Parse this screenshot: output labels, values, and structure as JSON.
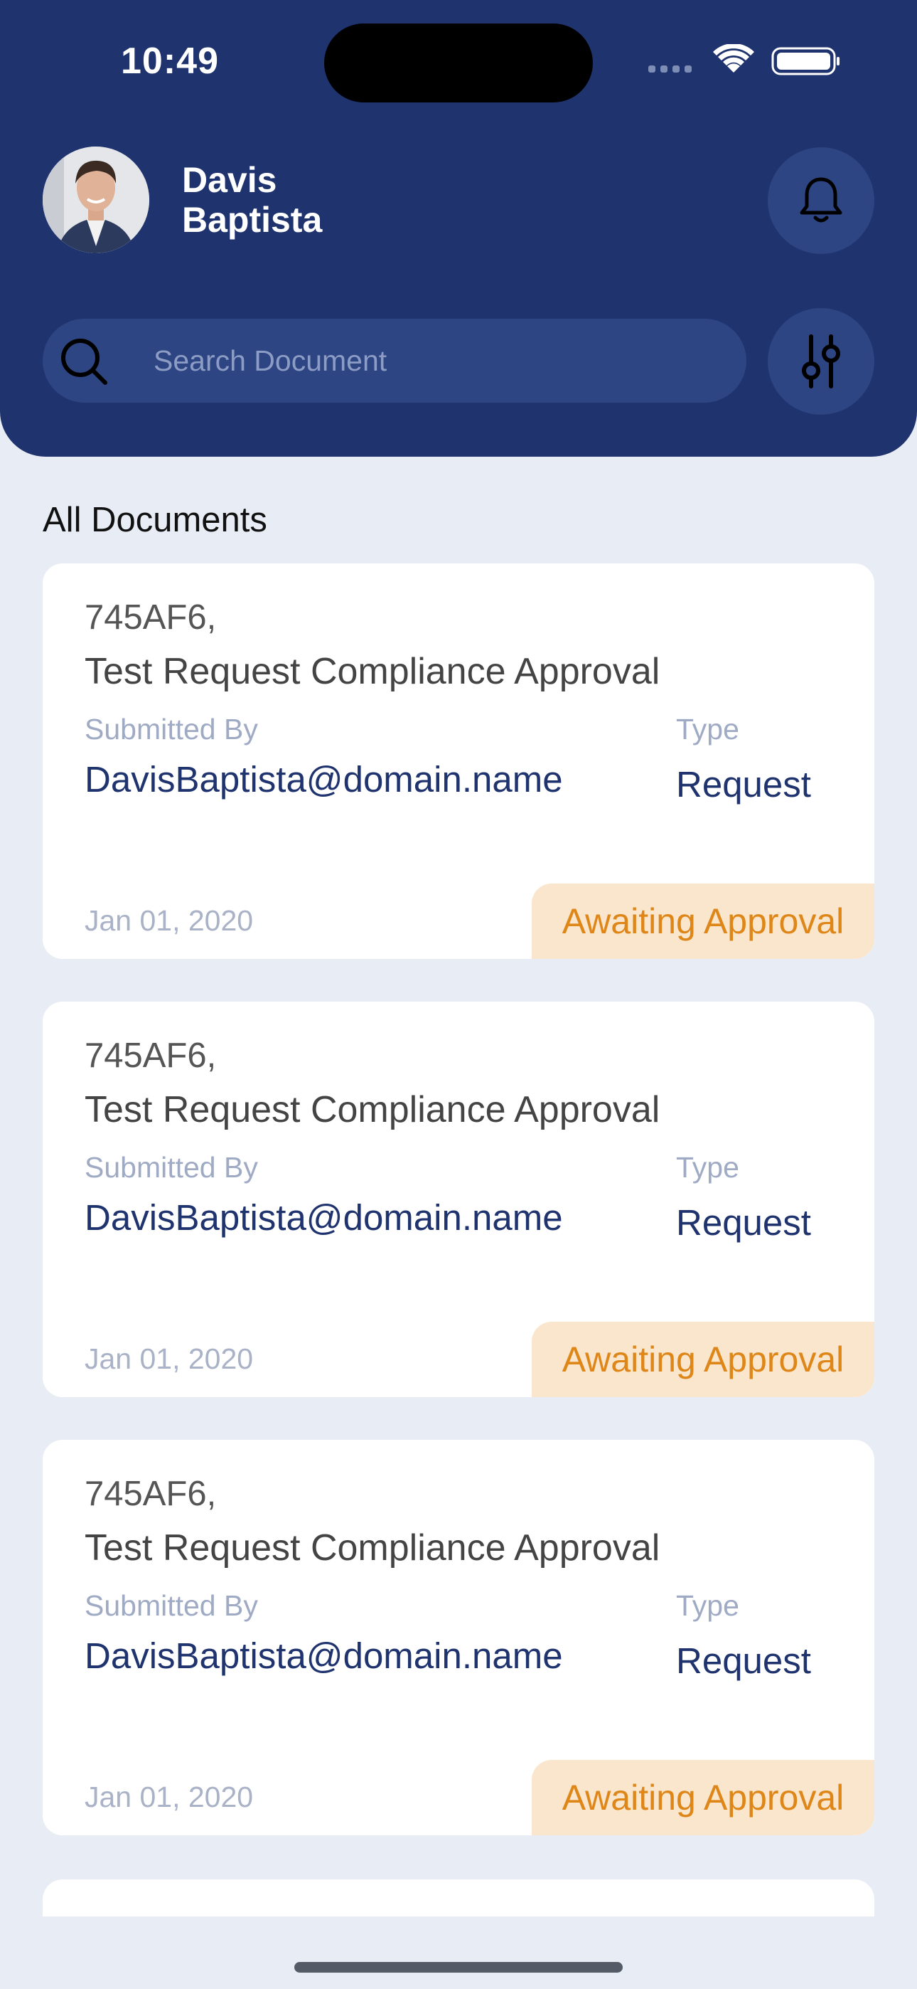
{
  "status_bar": {
    "time": "10:49"
  },
  "header": {
    "user_name": "Davis Baptista",
    "search": {
      "placeholder": "Search Document",
      "value": ""
    },
    "icons": [
      "bell-icon",
      "search-icon",
      "filter-icon"
    ],
    "background_color": "#1F336E"
  },
  "section_title": "All Documents",
  "documents": [
    {
      "id": "745AF6,",
      "title": "Test Request Compliance Approval",
      "submitted_by_label": "Submitted By",
      "submitted_by": "DavisBaptista@domain.name",
      "type_label": "Type",
      "type": "Request",
      "date": "Jan 01, 2020",
      "status": "Awaiting Approval"
    },
    {
      "id": "745AF6,",
      "title": "Test Request Compliance Approval",
      "submitted_by_label": "Submitted By",
      "submitted_by": "DavisBaptista@domain.name",
      "type_label": "Type",
      "type": "Request",
      "date": "Jan 01, 2020",
      "status": "Awaiting Approval"
    },
    {
      "id": "745AF6,",
      "title": "Test Request Compliance Approval",
      "submitted_by_label": "Submitted By",
      "submitted_by": "DavisBaptista@domain.name",
      "type_label": "Type",
      "type": "Request",
      "date": "Jan 01, 2020",
      "status": "Awaiting Approval"
    }
  ],
  "colors": {
    "status_text": "#DE8618",
    "status_bg": "#FAE6CC",
    "accent": "#1F336E",
    "page_bg": "#E8ECF4"
  }
}
